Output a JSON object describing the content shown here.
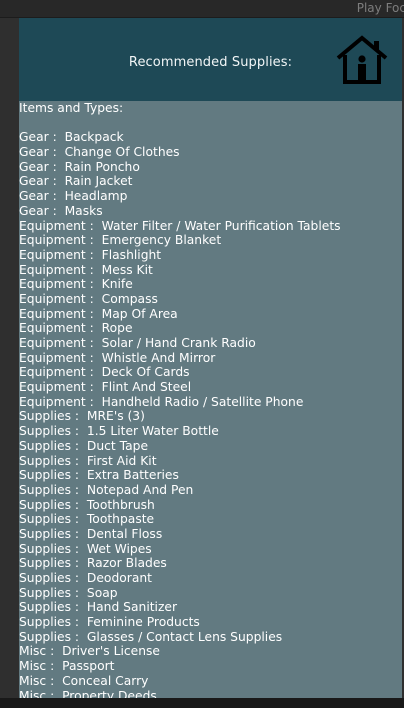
{
  "editor": {
    "tab_label": "Play Foc"
  },
  "header": {
    "title": "Recommended Supplies:",
    "home_icon": "home-icon"
  },
  "content": {
    "heading": "Items and Types:",
    "items": [
      {
        "type": "Gear",
        "name": "Backpack"
      },
      {
        "type": "Gear",
        "name": "Change Of Clothes"
      },
      {
        "type": "Gear",
        "name": "Rain Poncho"
      },
      {
        "type": "Gear",
        "name": "Rain Jacket"
      },
      {
        "type": "Gear",
        "name": "Headlamp"
      },
      {
        "type": "Gear",
        "name": "Masks"
      },
      {
        "type": "Equipment",
        "name": "Water Filter / Water Purification Tablets"
      },
      {
        "type": "Equipment",
        "name": "Emergency Blanket"
      },
      {
        "type": "Equipment",
        "name": "Flashlight"
      },
      {
        "type": "Equipment",
        "name": "Mess Kit"
      },
      {
        "type": "Equipment",
        "name": "Knife"
      },
      {
        "type": "Equipment",
        "name": "Compass"
      },
      {
        "type": "Equipment",
        "name": "Map Of Area"
      },
      {
        "type": "Equipment",
        "name": "Rope"
      },
      {
        "type": "Equipment",
        "name": "Solar / Hand Crank Radio"
      },
      {
        "type": "Equipment",
        "name": "Whistle And Mirror"
      },
      {
        "type": "Equipment",
        "name": "Deck Of Cards"
      },
      {
        "type": "Equipment",
        "name": "Flint And Steel"
      },
      {
        "type": "Equipment",
        "name": "Handheld Radio / Satellite Phone"
      },
      {
        "type": "Supplies",
        "name": "MRE's (3)"
      },
      {
        "type": "Supplies",
        "name": "1.5 Liter Water Bottle"
      },
      {
        "type": "Supplies",
        "name": "Duct Tape"
      },
      {
        "type": "Supplies",
        "name": "First Aid Kit"
      },
      {
        "type": "Supplies",
        "name": "Extra Batteries"
      },
      {
        "type": "Supplies",
        "name": "Notepad And Pen"
      },
      {
        "type": "Supplies",
        "name": "Toothbrush"
      },
      {
        "type": "Supplies",
        "name": "Toothpaste"
      },
      {
        "type": "Supplies",
        "name": "Dental Floss"
      },
      {
        "type": "Supplies",
        "name": "Wet Wipes"
      },
      {
        "type": "Supplies",
        "name": "Razor Blades"
      },
      {
        "type": "Supplies",
        "name": "Deodorant"
      },
      {
        "type": "Supplies",
        "name": "Soap"
      },
      {
        "type": "Supplies",
        "name": "Hand Sanitizer"
      },
      {
        "type": "Supplies",
        "name": "Feminine Products"
      },
      {
        "type": "Supplies",
        "name": "Glasses / Contact Lens Supplies"
      },
      {
        "type": "Misc",
        "name": "Driver's License"
      },
      {
        "type": "Misc",
        "name": "Passport"
      },
      {
        "type": "Misc",
        "name": "Conceal Carry"
      },
      {
        "type": "Misc",
        "name": "Property Deeds"
      }
    ]
  },
  "colors": {
    "header_bg": "#1e4956",
    "content_bg": "#627a81",
    "text": "#ffffff"
  }
}
